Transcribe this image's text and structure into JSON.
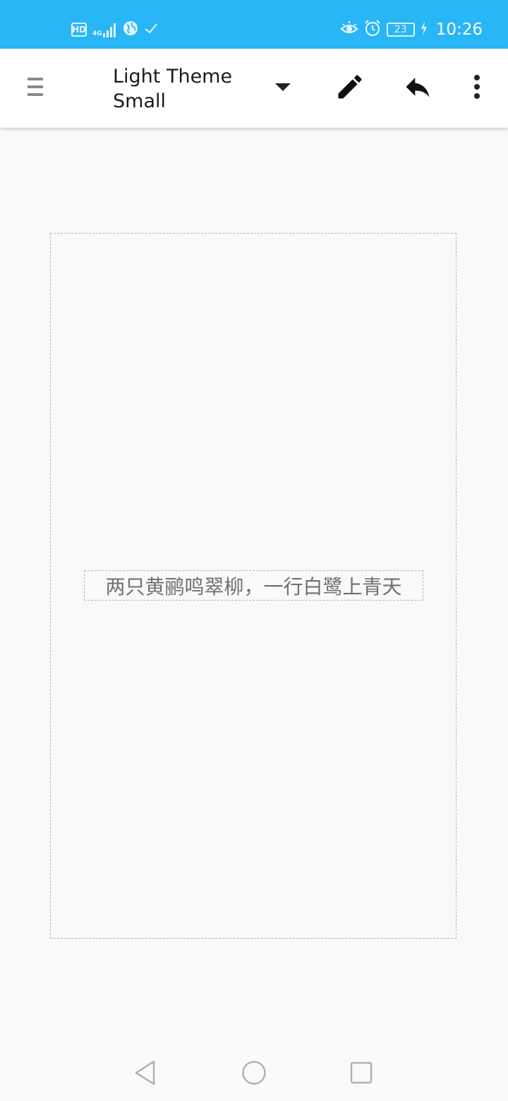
{
  "status_bar": {
    "hd_badge": "HD",
    "network_type": "4G",
    "battery_level": "23",
    "time": "10:26",
    "icons": [
      "hd-icon",
      "signal-icon",
      "globe-icon",
      "check-icon",
      "eye-icon",
      "alarm-icon",
      "battery-icon",
      "charging-icon"
    ]
  },
  "app_bar": {
    "title_line1": "Light Theme",
    "title_line2": "Small",
    "icons": [
      "menu-icon",
      "dropdown-arrow-icon",
      "pencil-icon",
      "undo-icon",
      "more-vert-icon"
    ]
  },
  "canvas": {
    "text": "两只黄鹂鸣翠柳，一行白鹭上青天"
  },
  "nav_bar": {
    "icons": [
      "back-icon",
      "home-icon",
      "recents-icon"
    ]
  },
  "colors": {
    "status_bar": "#29b6f6",
    "app_bar": "#ffffff",
    "background": "#f9f9f9",
    "text_gray": "#6f6f6f",
    "dashed_border": "#b3b3b3"
  }
}
